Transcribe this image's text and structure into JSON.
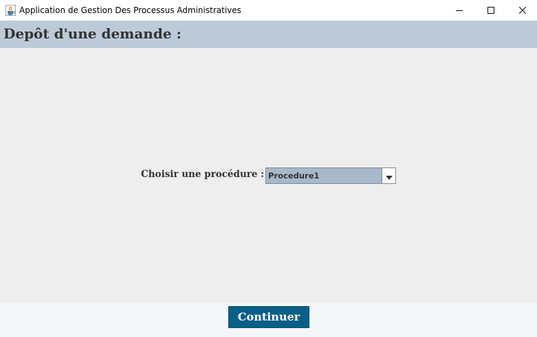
{
  "window": {
    "title": "Application de Gestion Des Processus Administratives",
    "app_icon": "java-cup-icon",
    "controls": [
      "minimize-icon",
      "maximize-icon",
      "close-icon"
    ]
  },
  "header": {
    "title": "Depôt d'une demande :"
  },
  "form": {
    "procedure_label": "Choisir une procédure :",
    "procedure_selected": "Procedure1",
    "dropdown_icon": "chevron-down-icon"
  },
  "footer": {
    "continue_label": "Continuer"
  },
  "colors": {
    "header_bg": "#bdcad8",
    "main_bg": "#eeeeee",
    "combo_bg": "#a8b8cb",
    "button_bg": "#0a5f87",
    "footer_bg": "#f4f6fa"
  }
}
